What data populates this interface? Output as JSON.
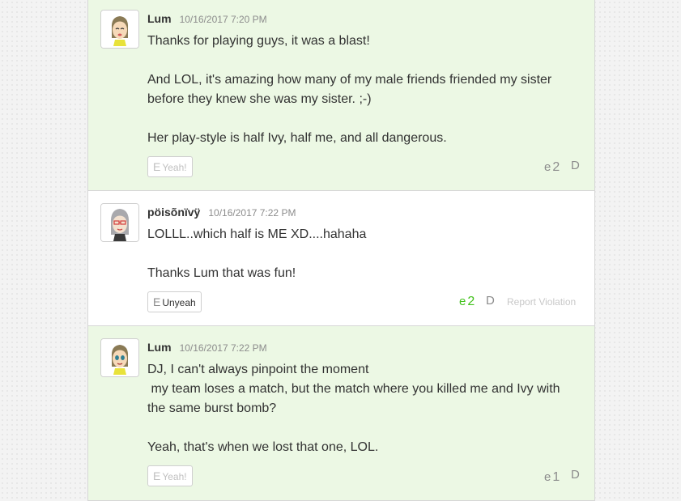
{
  "replies": [
    {
      "author": "Lum",
      "timestamp": "10/16/2017 7:20 PM",
      "body": "Thanks for playing guys, it was a blast!\n\nAnd LOL, it's amazing how many of my male friends friended my sister before they knew she was my sister. ;-)\n\nHer play-style is half Ivy, half me, and all dangerous.",
      "yeah_glyph": "E",
      "yeah_label": "Yeah!",
      "count_glyph": "e",
      "count": "2",
      "reply_glyph": "D",
      "avatar_icon": "mii-avatar-icon"
    },
    {
      "author": "pöisõnïvÿ",
      "timestamp": "10/16/2017 7:22 PM",
      "body": "LOLLL..which half is ME XD....hahaha\n\nThanks Lum that was fun!",
      "yeah_glyph": "E",
      "yeah_label": "Unyeah",
      "count_glyph": "e",
      "count": "2",
      "reply_glyph": "D",
      "report_label": "Report Violation",
      "avatar_icon": "mii-avatar-icon"
    },
    {
      "author": "Lum",
      "timestamp": "10/16/2017 7:22 PM",
      "body": "DJ, I can't always pinpoint the moment\n my team loses a match, but the match where you killed me and Ivy with the same burst bomb?\n\nYeah, that's when we lost that one, LOL.",
      "yeah_glyph": "E",
      "yeah_label": "Yeah!",
      "count_glyph": "e",
      "count": "1",
      "reply_glyph": "D",
      "avatar_icon": "mii-avatar-icon"
    }
  ],
  "colors": {
    "own_reply_bg": "#ecf8e4",
    "yeah_active": "#43c11d",
    "muted_text": "#8c8c8c"
  }
}
